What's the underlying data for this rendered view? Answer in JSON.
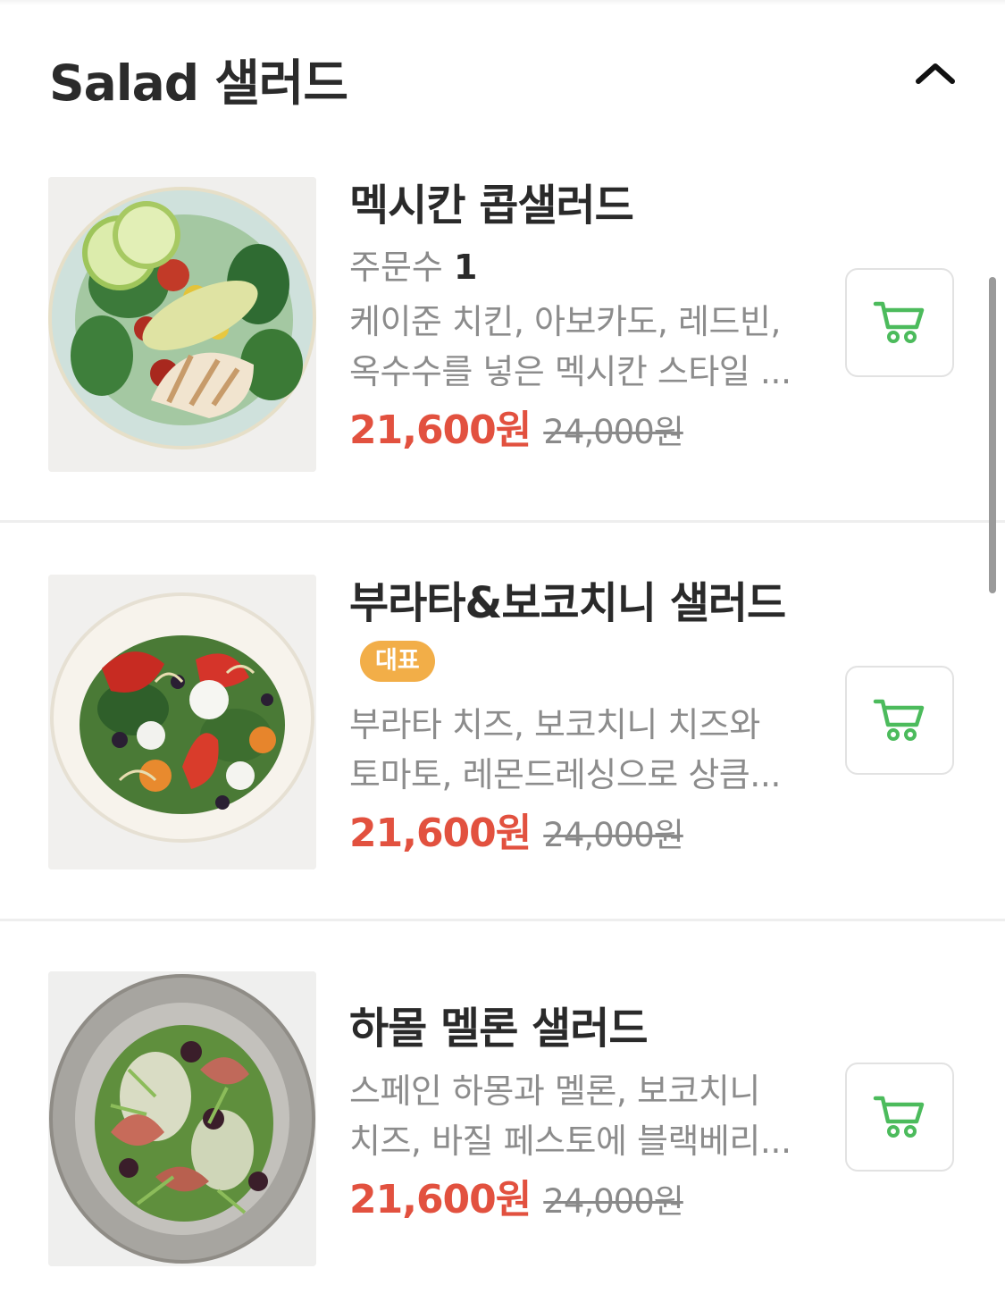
{
  "section": {
    "title": "Salad 샐러드",
    "collapse_icon": "chevron-up-icon"
  },
  "items": [
    {
      "name": "멕시칸 콥샐러드",
      "order_label": "주문수",
      "order_count": "1",
      "description": "케이준 치킨, 아보카도, 레드빈, 옥수수를 넣은 멕시칸 스타일 ...",
      "price": "21,600원",
      "original_price": "24,000원",
      "cart_icon": "cart-icon"
    },
    {
      "name": "부라타&보코치니 샐러드",
      "badge": "대표",
      "description": "부라타 치즈, 보코치니 치즈와 토마토, 레몬드레싱으로 상큼...",
      "price": "21,600원",
      "original_price": "24,000원",
      "cart_icon": "cart-icon"
    },
    {
      "name": "하몰 멜론 샐러드",
      "description": "스페인 하몽과 멜론, 보코치니 치즈, 바질 페스토에 블랙베리...",
      "price": "21,600원",
      "original_price": "24,000원",
      "cart_icon": "cart-icon"
    }
  ],
  "colors": {
    "price": "#e2513f",
    "badge": "#f2ae48",
    "cart": "#4cbb5c"
  }
}
